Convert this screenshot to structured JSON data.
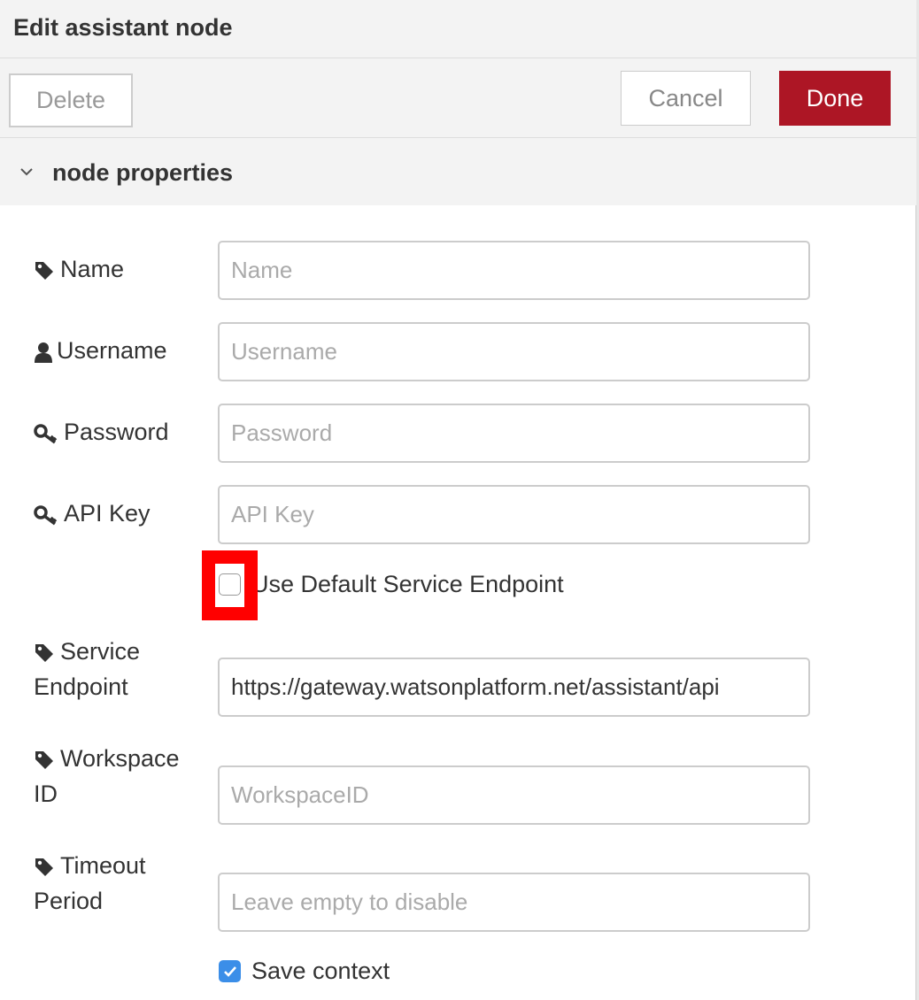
{
  "title": "Edit assistant node",
  "toolbar": {
    "delete_label": "Delete",
    "cancel_label": "Cancel",
    "done_label": "Done"
  },
  "section": {
    "title": "node properties",
    "icon": "chevron-down-icon"
  },
  "fields": {
    "name": {
      "label": "Name",
      "icon": "tag-icon",
      "value": "",
      "placeholder": "Name"
    },
    "username": {
      "label": "Username",
      "icon": "user-icon",
      "value": "",
      "placeholder": "Username"
    },
    "password": {
      "label": "Password",
      "icon": "key-icon",
      "value": "",
      "placeholder": "Password"
    },
    "apikey": {
      "label": "API Key",
      "icon": "key-icon",
      "value": "",
      "placeholder": "API Key"
    },
    "default_endpoint": {
      "label": "Use Default Service Endpoint",
      "checked": false
    },
    "service_endpoint": {
      "label_line1": "Service",
      "label_line2": "Endpoint",
      "icon": "tag-icon",
      "value": "https://gateway.watsonplatform.net/assistant/api",
      "placeholder": ""
    },
    "workspace_id": {
      "label_line1": "Workspace",
      "label_line2": "ID",
      "icon": "tag-icon",
      "value": "",
      "placeholder": "WorkspaceID"
    },
    "timeout": {
      "label_line1": "Timeout",
      "label_line2": "Period",
      "icon": "tag-icon",
      "value": "",
      "placeholder": "Leave empty to disable"
    },
    "save_context": {
      "label": "Save context",
      "checked": true
    }
  },
  "colors": {
    "done_button": "#ad1625",
    "checkbox_checked": "#3b8ee8",
    "highlight": "#ff0000"
  }
}
